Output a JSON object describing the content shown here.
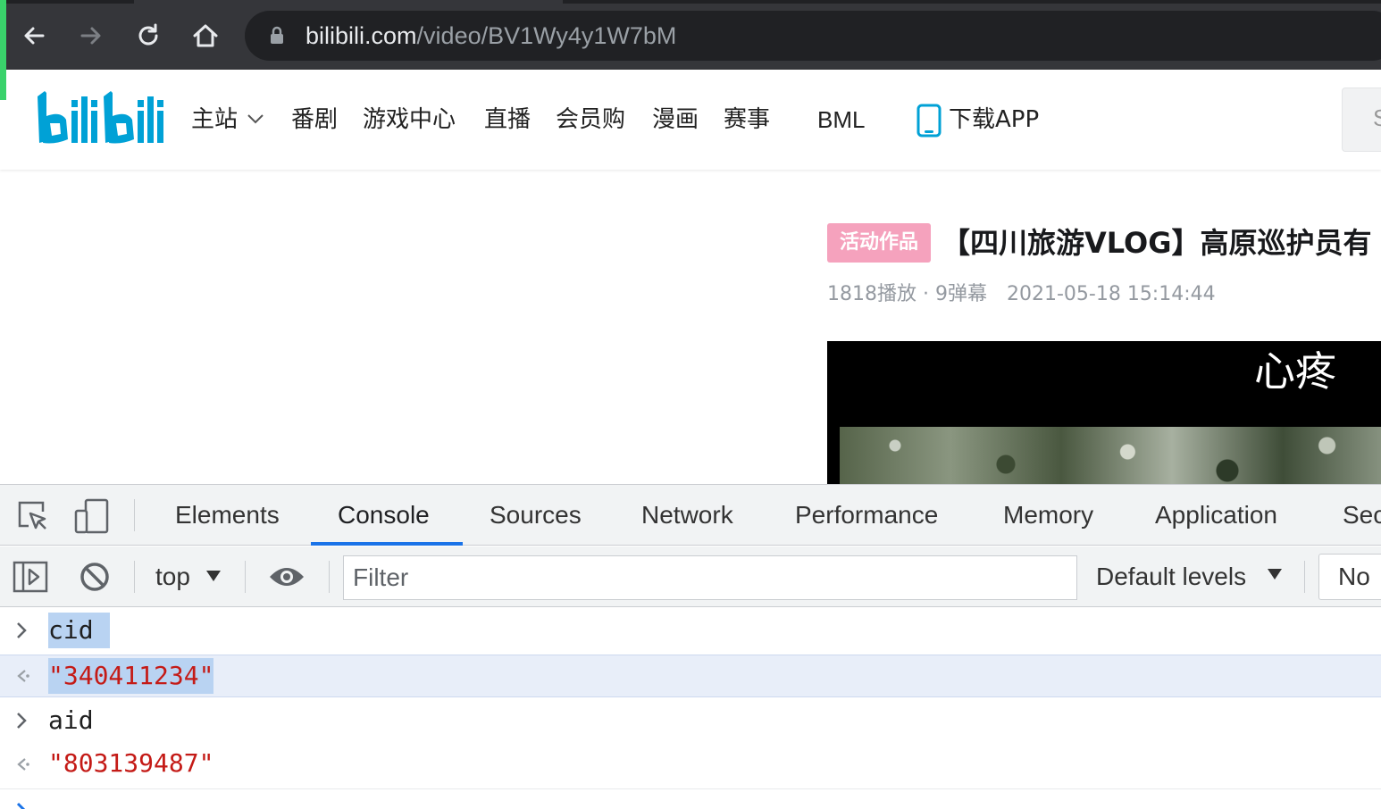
{
  "browser": {
    "url_host": "bilibili.com",
    "url_path": "/video/BV1Wy4y1W7bM",
    "icons": [
      "back-icon",
      "forward-icon",
      "reload-icon",
      "home-icon",
      "lock-icon"
    ]
  },
  "site_header": {
    "logo_text": "bilibili",
    "brand_color": "#00a1d6",
    "nav": [
      {
        "label": "主站",
        "has_dropdown": true
      },
      {
        "label": "番剧"
      },
      {
        "label": "游戏中心"
      },
      {
        "label": "直播"
      },
      {
        "label": "会员购"
      },
      {
        "label": "漫画"
      },
      {
        "label": "赛事"
      },
      {
        "label": "BML"
      },
      {
        "label": "下载APP",
        "icon": "phone-icon"
      }
    ],
    "search_partial": "S"
  },
  "video": {
    "badge": "活动作品",
    "badge_color": "#f5a2bd",
    "title": "【四川旅游VLOG】高原巡护员有",
    "meta_views": "1818播放 · 9弹幕",
    "meta_date": "2021-05-18 15:14:44",
    "player_subtitle": "心疼"
  },
  "devtools": {
    "tabs": [
      "Elements",
      "Console",
      "Sources",
      "Network",
      "Performance",
      "Memory",
      "Application",
      "Security"
    ],
    "active_tab": "Console",
    "context": "top",
    "filter_placeholder": "Filter",
    "levels": "Default levels",
    "issues_partial": "No",
    "accent": "#1a73e8",
    "console": [
      {
        "type": "input",
        "text": "cid",
        "selected": true
      },
      {
        "type": "result",
        "text": "\"340411234\"",
        "selected": true
      },
      {
        "type": "input",
        "text": "aid"
      },
      {
        "type": "result",
        "text": "\"803139487\""
      }
    ]
  }
}
